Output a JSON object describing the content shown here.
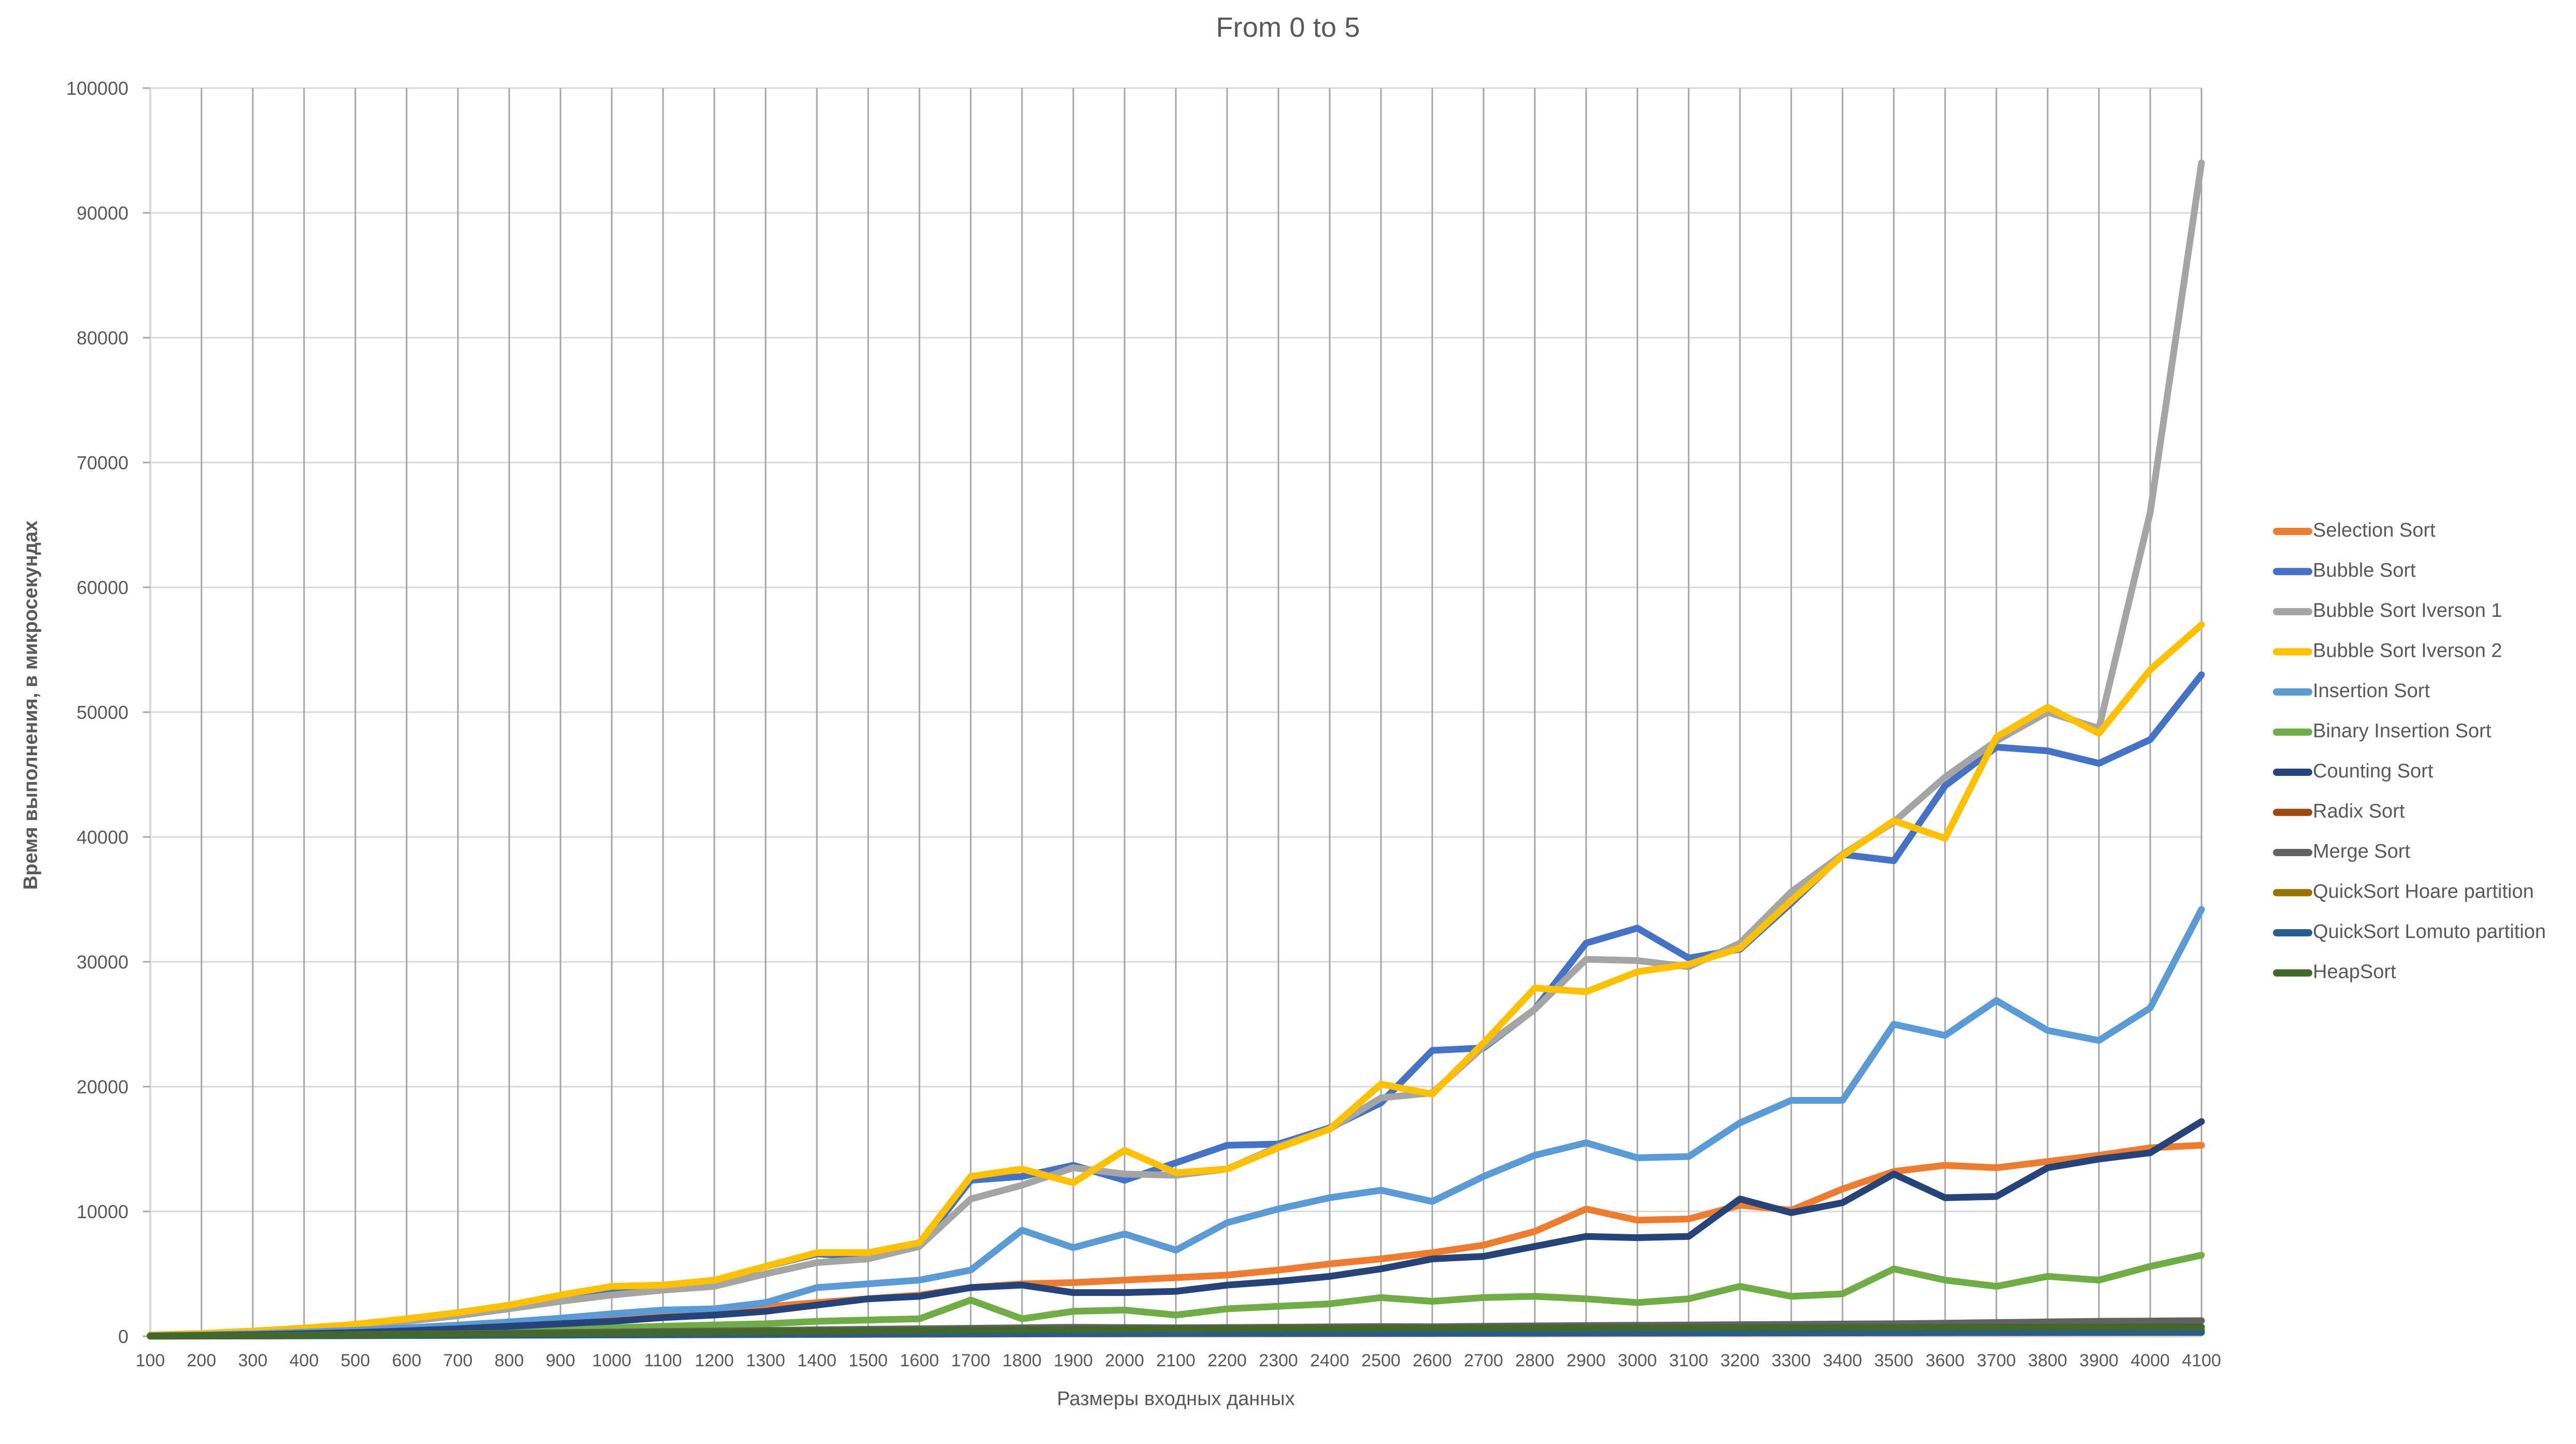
{
  "chart_data": {
    "type": "line",
    "title": "From 0 to 5",
    "xlabel": "Размеры  входных данных",
    "ylabel": "Время выполнения, в микросекундах",
    "xlim": [
      100,
      4100
    ],
    "ylim": [
      0,
      100000
    ],
    "y_tick_step": 10000,
    "y_ticks": [
      "0",
      "10000",
      "20000",
      "30000",
      "40000",
      "50000",
      "60000",
      "70000",
      "80000",
      "90000",
      "100000"
    ],
    "grid": {
      "horizontal": true,
      "vertical": true
    },
    "legend_position": "right",
    "categories": [
      100,
      200,
      300,
      400,
      500,
      600,
      700,
      800,
      900,
      1000,
      1100,
      1200,
      1300,
      1400,
      1500,
      1600,
      1700,
      1800,
      1900,
      2000,
      2100,
      2200,
      2300,
      2400,
      2500,
      2600,
      2700,
      2800,
      2900,
      3000,
      3100,
      3200,
      3300,
      3400,
      3500,
      3600,
      3700,
      3800,
      3900,
      4000,
      4100
    ],
    "series": [
      {
        "name": "Selection Sort",
        "color": "#ED7D31",
        "values": [
          60,
          120,
          200,
          300,
          420,
          560,
          730,
          930,
          1150,
          1400,
          1700,
          2000,
          2350,
          2700,
          3000,
          3300,
          3900,
          4200,
          4300,
          4500,
          4700,
          4900,
          5300,
          5800,
          6200,
          6700,
          7300,
          8400,
          10200,
          9300,
          9400,
          10500,
          10100,
          11800,
          13200,
          13700,
          13500,
          14000,
          14500,
          15100,
          15300
        ]
      },
      {
        "name": "Bubble Sort",
        "color": "#4472C4",
        "values": [
          90,
          200,
          380,
          600,
          900,
          1300,
          1800,
          2400,
          3200,
          3800,
          4100,
          4400,
          5600,
          6600,
          6300,
          7200,
          12500,
          12800,
          13700,
          12500,
          13900,
          15300,
          15400,
          16700,
          18700,
          22900,
          23100,
          26200,
          31500,
          32700,
          30300,
          31000,
          34700,
          38600,
          38100,
          44100,
          47200,
          46900,
          45900,
          47800,
          53000
        ]
      },
      {
        "name": "Bubble Sort Iverson 1",
        "color": "#A5A5A5",
        "values": [
          70,
          170,
          330,
          540,
          820,
          1200,
          1650,
          2200,
          2800,
          3300,
          3700,
          4000,
          5000,
          5900,
          6200,
          7200,
          11000,
          12100,
          13500,
          13000,
          12900,
          13400,
          15200,
          16600,
          19100,
          19500,
          23200,
          26200,
          30200,
          30100,
          29600,
          31500,
          35600,
          38600,
          41200,
          44800,
          47700,
          50000,
          48700,
          66000,
          94000
        ]
      },
      {
        "name": "Bubble Sort Iverson 2",
        "color": "#FFC000",
        "values": [
          100,
          230,
          420,
          660,
          960,
          1400,
          1900,
          2500,
          3300,
          4000,
          4100,
          4500,
          5600,
          6700,
          6700,
          7500,
          12800,
          13400,
          12300,
          14900,
          13100,
          13400,
          15100,
          16600,
          20200,
          19400,
          23500,
          27900,
          27600,
          29200,
          29800,
          31100,
          34900,
          38500,
          41300,
          39900,
          48000,
          50400,
          48300,
          53400,
          57000
        ]
      },
      {
        "name": "Insertion Sort",
        "color": "#5B9BD5",
        "values": [
          40,
          110,
          200,
          330,
          480,
          670,
          900,
          1150,
          1450,
          1800,
          2100,
          2200,
          2700,
          3900,
          4200,
          4500,
          5300,
          8500,
          7100,
          8200,
          6900,
          9100,
          10200,
          11100,
          11700,
          10800,
          12800,
          14500,
          15500,
          14300,
          14400,
          17100,
          18900,
          18900,
          25000,
          24100,
          26900,
          24500,
          23700,
          26300,
          34200
        ]
      },
      {
        "name": "Binary Insertion Sort",
        "color": "#70AD47",
        "values": [
          30,
          70,
          110,
          160,
          230,
          300,
          380,
          460,
          560,
          680,
          800,
          900,
          1000,
          1200,
          1300,
          1400,
          2900,
          1400,
          2000,
          2100,
          1700,
          2200,
          2400,
          2600,
          3100,
          2800,
          3100,
          3200,
          3000,
          2700,
          3000,
          4000,
          3200,
          3400,
          5400,
          4500,
          4000,
          4800,
          4500,
          5600,
          6500
        ]
      },
      {
        "name": "Counting Sort",
        "color": "#264478",
        "values": [
          20,
          60,
          120,
          200,
          300,
          430,
          600,
          800,
          1000,
          1200,
          1500,
          1700,
          2000,
          2500,
          3000,
          3200,
          3900,
          4100,
          3500,
          3500,
          3600,
          4100,
          4400,
          4800,
          5400,
          6200,
          6400,
          7200,
          8000,
          7900,
          8000,
          11000,
          9900,
          10700,
          13000,
          11100,
          11200,
          13500,
          14200,
          14700,
          17200
        ]
      },
      {
        "name": "Radix Sort",
        "color": "#9E480E",
        "values": [
          15,
          25,
          35,
          45,
          55,
          65,
          75,
          85,
          95,
          105,
          115,
          125,
          135,
          145,
          155,
          165,
          175,
          185,
          195,
          200,
          205,
          210,
          215,
          220,
          225,
          230,
          235,
          240,
          245,
          250,
          255,
          260,
          265,
          270,
          275,
          280,
          285,
          290,
          295,
          300,
          305
        ]
      },
      {
        "name": "Merge Sort",
        "color": "#636363",
        "values": [
          20,
          45,
          70,
          100,
          130,
          170,
          210,
          250,
          300,
          340,
          390,
          430,
          470,
          520,
          560,
          600,
          640,
          680,
          720,
          700,
          680,
          700,
          720,
          750,
          780,
          760,
          800,
          830,
          860,
          880,
          900,
          930,
          950,
          980,
          1000,
          1050,
          1100,
          1150,
          1200,
          1220,
          1250
        ]
      },
      {
        "name": "QuickSort Hoare partition",
        "color": "#997300",
        "values": [
          10,
          20,
          30,
          45,
          60,
          80,
          100,
          120,
          140,
          160,
          180,
          200,
          220,
          240,
          260,
          275,
          290,
          305,
          320,
          330,
          340,
          350,
          360,
          370,
          380,
          390,
          400,
          410,
          420,
          425,
          430,
          440,
          445,
          450,
          460,
          470,
          480,
          490,
          500,
          510,
          520
        ]
      },
      {
        "name": "QuickSort Lomuto partition",
        "color": "#255E91",
        "values": [
          8,
          16,
          25,
          35,
          45,
          58,
          70,
          85,
          100,
          115,
          130,
          145,
          160,
          175,
          190,
          200,
          210,
          220,
          230,
          240,
          245,
          250,
          255,
          260,
          265,
          270,
          275,
          280,
          285,
          290,
          295,
          300,
          305,
          310,
          315,
          320,
          325,
          330,
          335,
          340,
          345
        ]
      },
      {
        "name": "HeapSort",
        "color": "#43682B",
        "values": [
          15,
          35,
          55,
          80,
          105,
          135,
          165,
          200,
          235,
          270,
          305,
          340,
          375,
          410,
          440,
          470,
          500,
          525,
          550,
          570,
          580,
          595,
          610,
          625,
          640,
          650,
          660,
          670,
          680,
          690,
          695,
          700,
          705,
          710,
          715,
          720,
          725,
          730,
          735,
          740,
          745
        ]
      }
    ]
  }
}
